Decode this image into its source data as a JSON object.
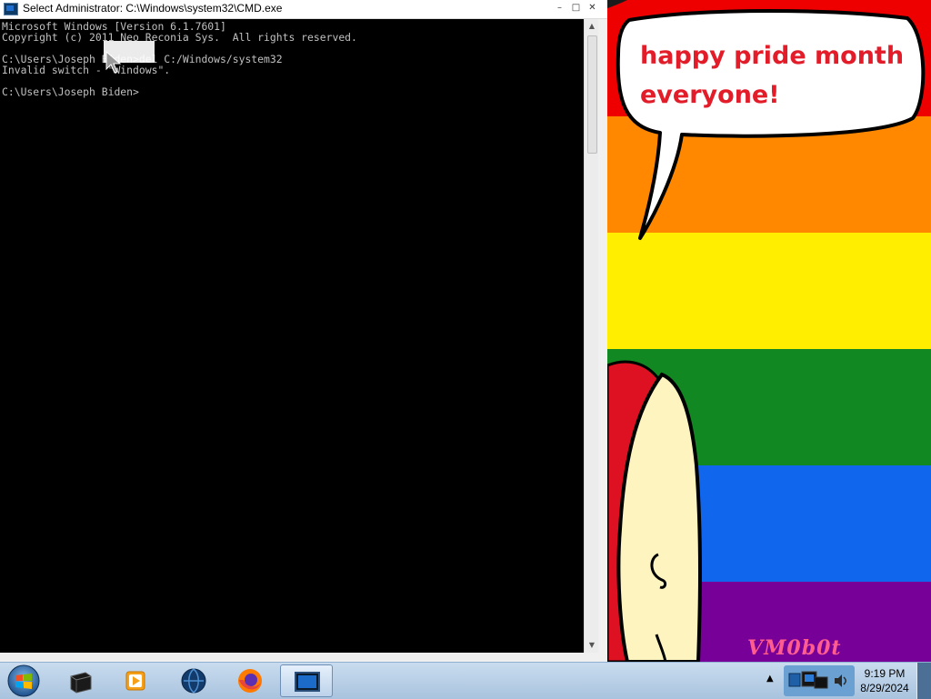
{
  "window": {
    "title": "Select Administrator: C:\\Windows\\system32\\CMD.exe",
    "minimize_glyph": "–",
    "maximize_glyph": "□",
    "close_glyph": "✕"
  },
  "console": {
    "lines": [
      "Microsoft Windows [Version 6.1.7601]",
      "Copyright (c) 2011 Neo Reconia Sys.  All rights reserved.",
      "",
      "C:\\Users\\Joseph Biden>del C:/Windows/system32",
      "Invalid switch - \"Windows\".",
      "",
      "C:\\Users\\Joseph Biden>"
    ],
    "text_color": "#c0c0c0",
    "background_color": "#000000"
  },
  "wallpaper": {
    "speech_bubble_lines": [
      "happy pride month",
      "everyone!"
    ],
    "watermark": "VM0b0t",
    "stripe_colors": [
      "#ee0000",
      "#ff8800",
      "#ffee00",
      "#118822",
      "#1166ee",
      "#770099"
    ]
  },
  "taskbar": {
    "start_icon": "windows-logo-icon",
    "items": [
      {
        "name": "computer-icon",
        "active": false
      },
      {
        "name": "media-player-icon",
        "active": false
      },
      {
        "name": "globe-browser-icon",
        "active": false
      },
      {
        "name": "firefox-icon",
        "active": false
      },
      {
        "name": "cmd-icon",
        "active": true
      }
    ],
    "tray_arrow": "▲",
    "tray_icons": [
      "network-icon",
      "volume-icon"
    ],
    "clock": {
      "time": "9:19 PM",
      "date": "8/29/2024"
    }
  }
}
